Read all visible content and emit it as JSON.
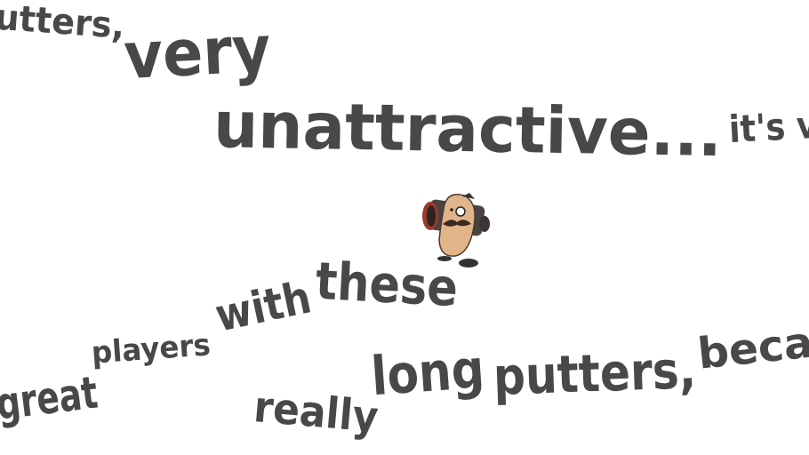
{
  "words": {
    "w1": "utters,",
    "w2": "very",
    "w3": "unattractive...",
    "w4": "it's v",
    "w5": "with",
    "w6": "these",
    "w7": "players",
    "w8": "great",
    "w9": "really",
    "w10": "long",
    "w11": "putters,",
    "w12": "beca"
  },
  "character": {
    "icon": "potato-character-with-cannon-icon",
    "colors": {
      "skin": "#e2b48a",
      "cannon": "#4a4341",
      "rim": "#9b3a2c",
      "text": "#4a4846"
    }
  }
}
